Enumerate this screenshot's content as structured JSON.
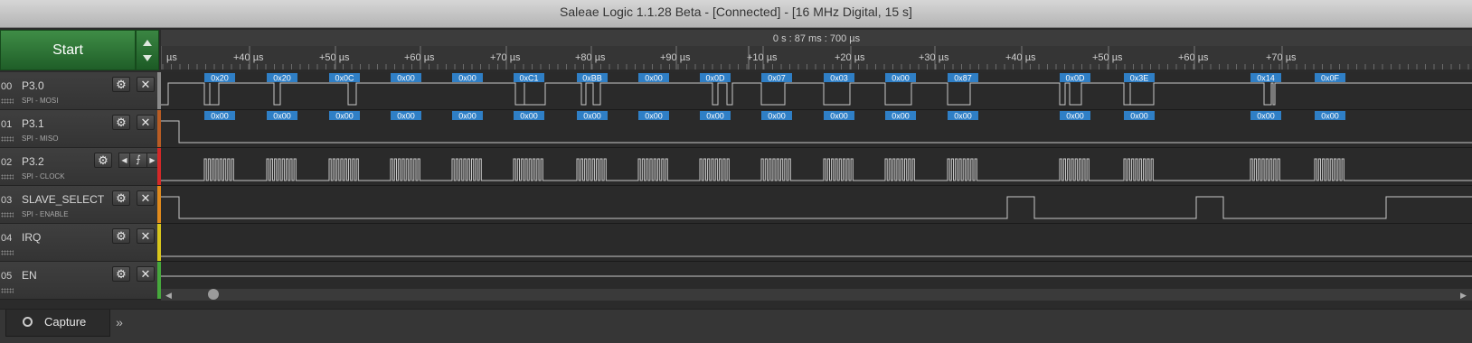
{
  "window": {
    "title": "Saleae Logic 1.1.28 Beta - [Connected] - [16 MHz Digital, 15 s]"
  },
  "toolbar": {
    "start_label": "Start"
  },
  "timeline": {
    "center_time": "0 s : 87 ms : 700 µs",
    "ticks": [
      "µs",
      "+40 µs",
      "+50 µs",
      "+60 µs",
      "+70 µs",
      "+80 µs",
      "+90 µs",
      "+10 µs",
      "+20 µs",
      "+30 µs",
      "+40 µs",
      "+50 µs",
      "+60 µs",
      "+70 µs"
    ]
  },
  "channels": [
    {
      "num": "00",
      "name": "P3.0",
      "sub": "SPI - MOSI",
      "color": "#8a8a8a"
    },
    {
      "num": "01",
      "name": "P3.1",
      "sub": "SPI - MISO",
      "color": "#b85c24"
    },
    {
      "num": "02",
      "name": "P3.2",
      "sub": "SPI - CLOCK",
      "color": "#d42828"
    },
    {
      "num": "03",
      "name": "SLAVE_SELECT",
      "sub": "SPI - ENABLE",
      "color": "#e08a1c"
    },
    {
      "num": "04",
      "name": "IRQ",
      "sub": "",
      "color": "#d8c61c"
    },
    {
      "num": "05",
      "name": "EN",
      "sub": "",
      "color": "#46a83c"
    }
  ],
  "icons": {
    "settings": "⚙",
    "close": "✕",
    "trigger_edge": "⨍",
    "prev": "◀",
    "next": "▶"
  },
  "mosi_labels": [
    "0x20",
    "0x20",
    "0x0C",
    "0x00",
    "0x00",
    "0xC1",
    "0xBB",
    "0x00",
    "0x0D",
    "0x07",
    "0x03",
    "0x00",
    "0x87",
    "0x0D",
    "0x3E",
    "0x14",
    "0x0F"
  ],
  "miso_labels": [
    "0x00",
    "0x00",
    "0x00",
    "0x00",
    "0x00",
    "0x00",
    "0x00",
    "0x00",
    "0x00",
    "0x00",
    "0x00",
    "0x00",
    "0x00",
    "0x00",
    "0x00",
    "0x00",
    "0x00"
  ],
  "bottom": {
    "capture_tab": "Capture",
    "more": "»"
  },
  "colors": {
    "accent_green": "#2f7a38",
    "label_blue": "#2f7fc6",
    "wave": "#c8c8c8"
  }
}
